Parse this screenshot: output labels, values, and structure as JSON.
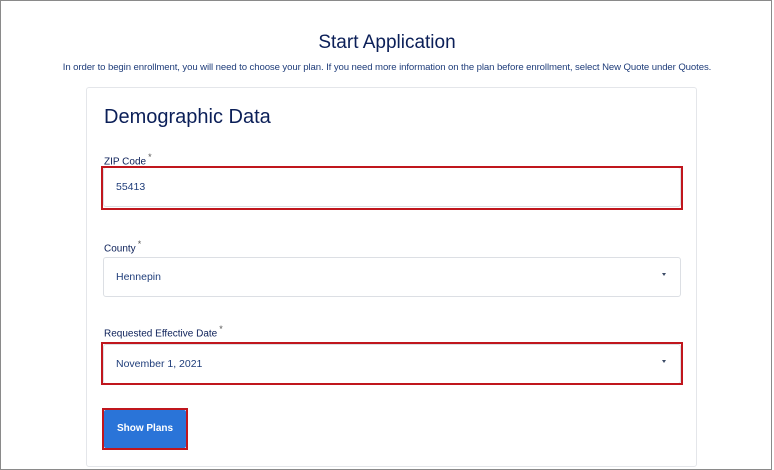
{
  "header": {
    "title": "Start Application",
    "description": "In order to begin enrollment, you will need to choose your plan. If you need more information on the plan before enrollment, select New Quote under Quotes."
  },
  "card": {
    "title": "Demographic Data",
    "zip": {
      "label": "ZIP Code",
      "required_mark": "*",
      "value": "55413"
    },
    "county": {
      "label": "County",
      "required_mark": "*",
      "value": "Hennepin"
    },
    "effective_date": {
      "label": "Requested Effective Date",
      "required_mark": "*",
      "value": "November 1, 2021"
    },
    "show_plans_label": "Show Plans"
  },
  "colors": {
    "heading": "#0b1f58",
    "text": "#1f3d7a",
    "button": "#2a74d8",
    "highlight": "#c0161d"
  }
}
